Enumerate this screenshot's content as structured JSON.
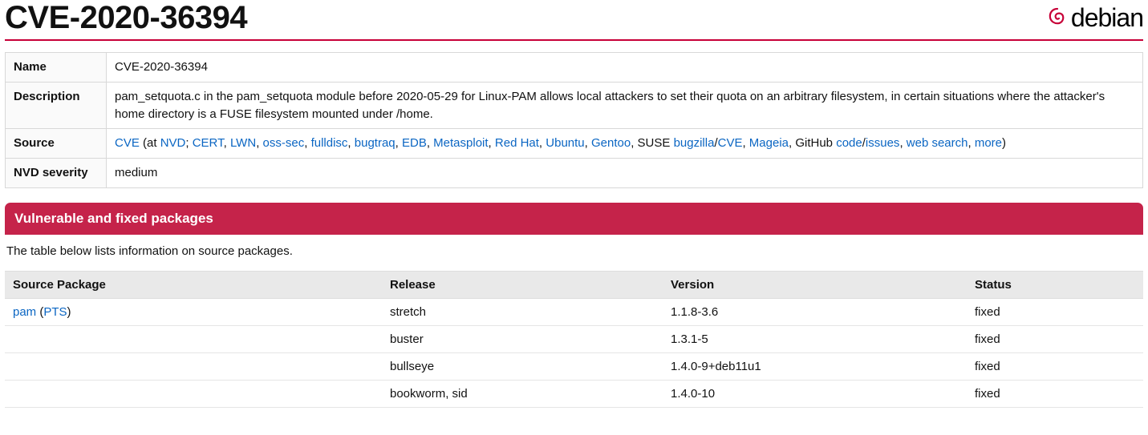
{
  "title": "CVE-2020-36394",
  "logo_text": "debian",
  "info": {
    "name_label": "Name",
    "name_value": "CVE-2020-36394",
    "desc_label": "Description",
    "desc_value": "pam_setquota.c in the pam_setquota module before 2020-05-29 for Linux-PAM allows local attackers to set their quota on an arbitrary filesystem, in certain situations where the attacker's home directory is a FUSE filesystem mounted under /home.",
    "source_label": "Source",
    "source": {
      "cve": "CVE",
      "at": " (at ",
      "nvd": "NVD",
      "semi": "; ",
      "cert": "CERT",
      "lwn": "LWN",
      "oss_sec": "oss-sec",
      "fulldisc": "fulldisc",
      "bugtraq": "bugtraq",
      "edb": "EDB",
      "metasploit": "Metasploit",
      "redhat": "Red Hat",
      "ubuntu": "Ubuntu",
      "gentoo": "Gentoo",
      "suse_text": "SUSE ",
      "bugzilla": "bugzilla",
      "slash": "/",
      "cve2": "CVE",
      "mageia": "Mageia",
      "github_text": "GitHub ",
      "code": "code",
      "issues": "issues",
      "web_search": "web search",
      "more": "more",
      "close": ")",
      "comma": ", "
    },
    "nvd_label": "NVD severity",
    "nvd_value": "medium"
  },
  "section_header": "Vulnerable and fixed packages",
  "intro": "The table below lists information on source packages.",
  "pkg_headers": {
    "source_package": "Source Package",
    "release": "Release",
    "version": "Version",
    "status": "Status"
  },
  "pkg_first": {
    "link": "pam",
    "open": " (",
    "pts": "PTS",
    "close": ")"
  },
  "pkg_rows": [
    {
      "release": "stretch",
      "version": "1.1.8-3.6",
      "status": "fixed"
    },
    {
      "release": "buster",
      "version": "1.3.1-5",
      "status": "fixed"
    },
    {
      "release": "bullseye",
      "version": "1.4.0-9+deb11u1",
      "status": "fixed"
    },
    {
      "release": "bookworm, sid",
      "version": "1.4.0-10",
      "status": "fixed"
    }
  ]
}
